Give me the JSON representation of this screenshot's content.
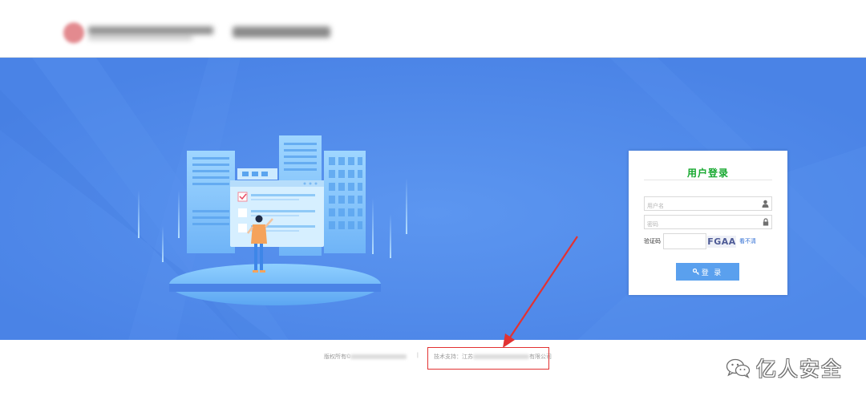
{
  "header": {
    "org_name_redacted": "",
    "system_name_redacted": ""
  },
  "login": {
    "title": "用户登录",
    "username_placeholder": "用户名",
    "password_placeholder": "密码",
    "captcha_label": "验证码",
    "captcha_text": "FGAA",
    "refresh_label": "看不清",
    "submit_label": "登 录"
  },
  "footer": {
    "copyright_prefix": "版权所有©",
    "separator": "|",
    "tech_support_prefix": "技术支持：江苏",
    "tech_support_suffix": "有限公司"
  },
  "watermark": {
    "text": "亿人安全"
  },
  "colors": {
    "banner_blue": "#4a83e6",
    "title_green": "#16a82f",
    "button_blue": "#5aa0ee",
    "highlight_red": "#e23232"
  }
}
